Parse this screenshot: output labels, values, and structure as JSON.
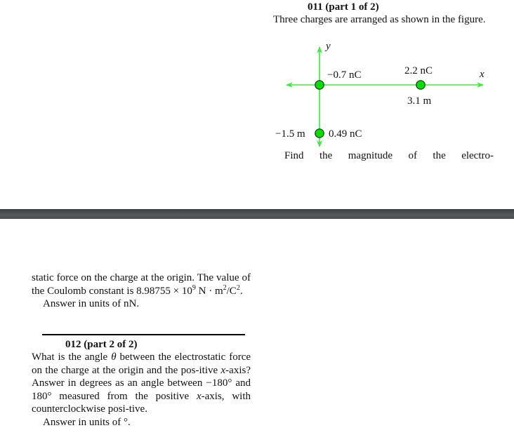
{
  "problem1": {
    "title": "011 (part 1 of 2)",
    "intro": "Three charges are arranged as shown in the figure.",
    "question_start": "Find the magnitude of the electro-",
    "question_cont": "static force on the charge at the origin. The value of the Coulomb constant is",
    "constant_mantissa": "8.98755 × 10",
    "constant_exp": "9",
    "constant_units_a": " N · m",
    "constant_units_exp1": "2",
    "constant_units_b": "/C",
    "constant_units_exp2": "2",
    "constant_end": ".",
    "answer_units": "Answer in units of  nN."
  },
  "diagram": {
    "axis_x_label": "x",
    "axis_y_label": "y",
    "colors": {
      "axis": "#3ee83e",
      "charge_fill": "#00dd00",
      "charge_stroke": "#0a3a0a"
    },
    "charges": [
      {
        "label": "−0.7 nC",
        "position_label": "",
        "x_m": 0,
        "y_m": 0
      },
      {
        "label": "2.2 nC",
        "position_label": "3.1 m",
        "x_m": 3.1,
        "y_m": 0
      },
      {
        "label": "0.49 nC",
        "position_label": "−1.5 m",
        "x_m": 0,
        "y_m": -1.5
      }
    ]
  },
  "problem2": {
    "title": "012 (part 2 of 2)",
    "q_a": "What is the angle ",
    "theta": "θ",
    "q_b": " between the electrostatic force on the charge at the origin and the pos-itive ",
    "x1": "x",
    "q_c": "-axis? Answer in degrees as an angle between −180° and 180° measured from the positive ",
    "x2": "x",
    "q_d": "-axis, with counterclockwise posi-tive.",
    "answer_units": "Answer in units of °."
  }
}
